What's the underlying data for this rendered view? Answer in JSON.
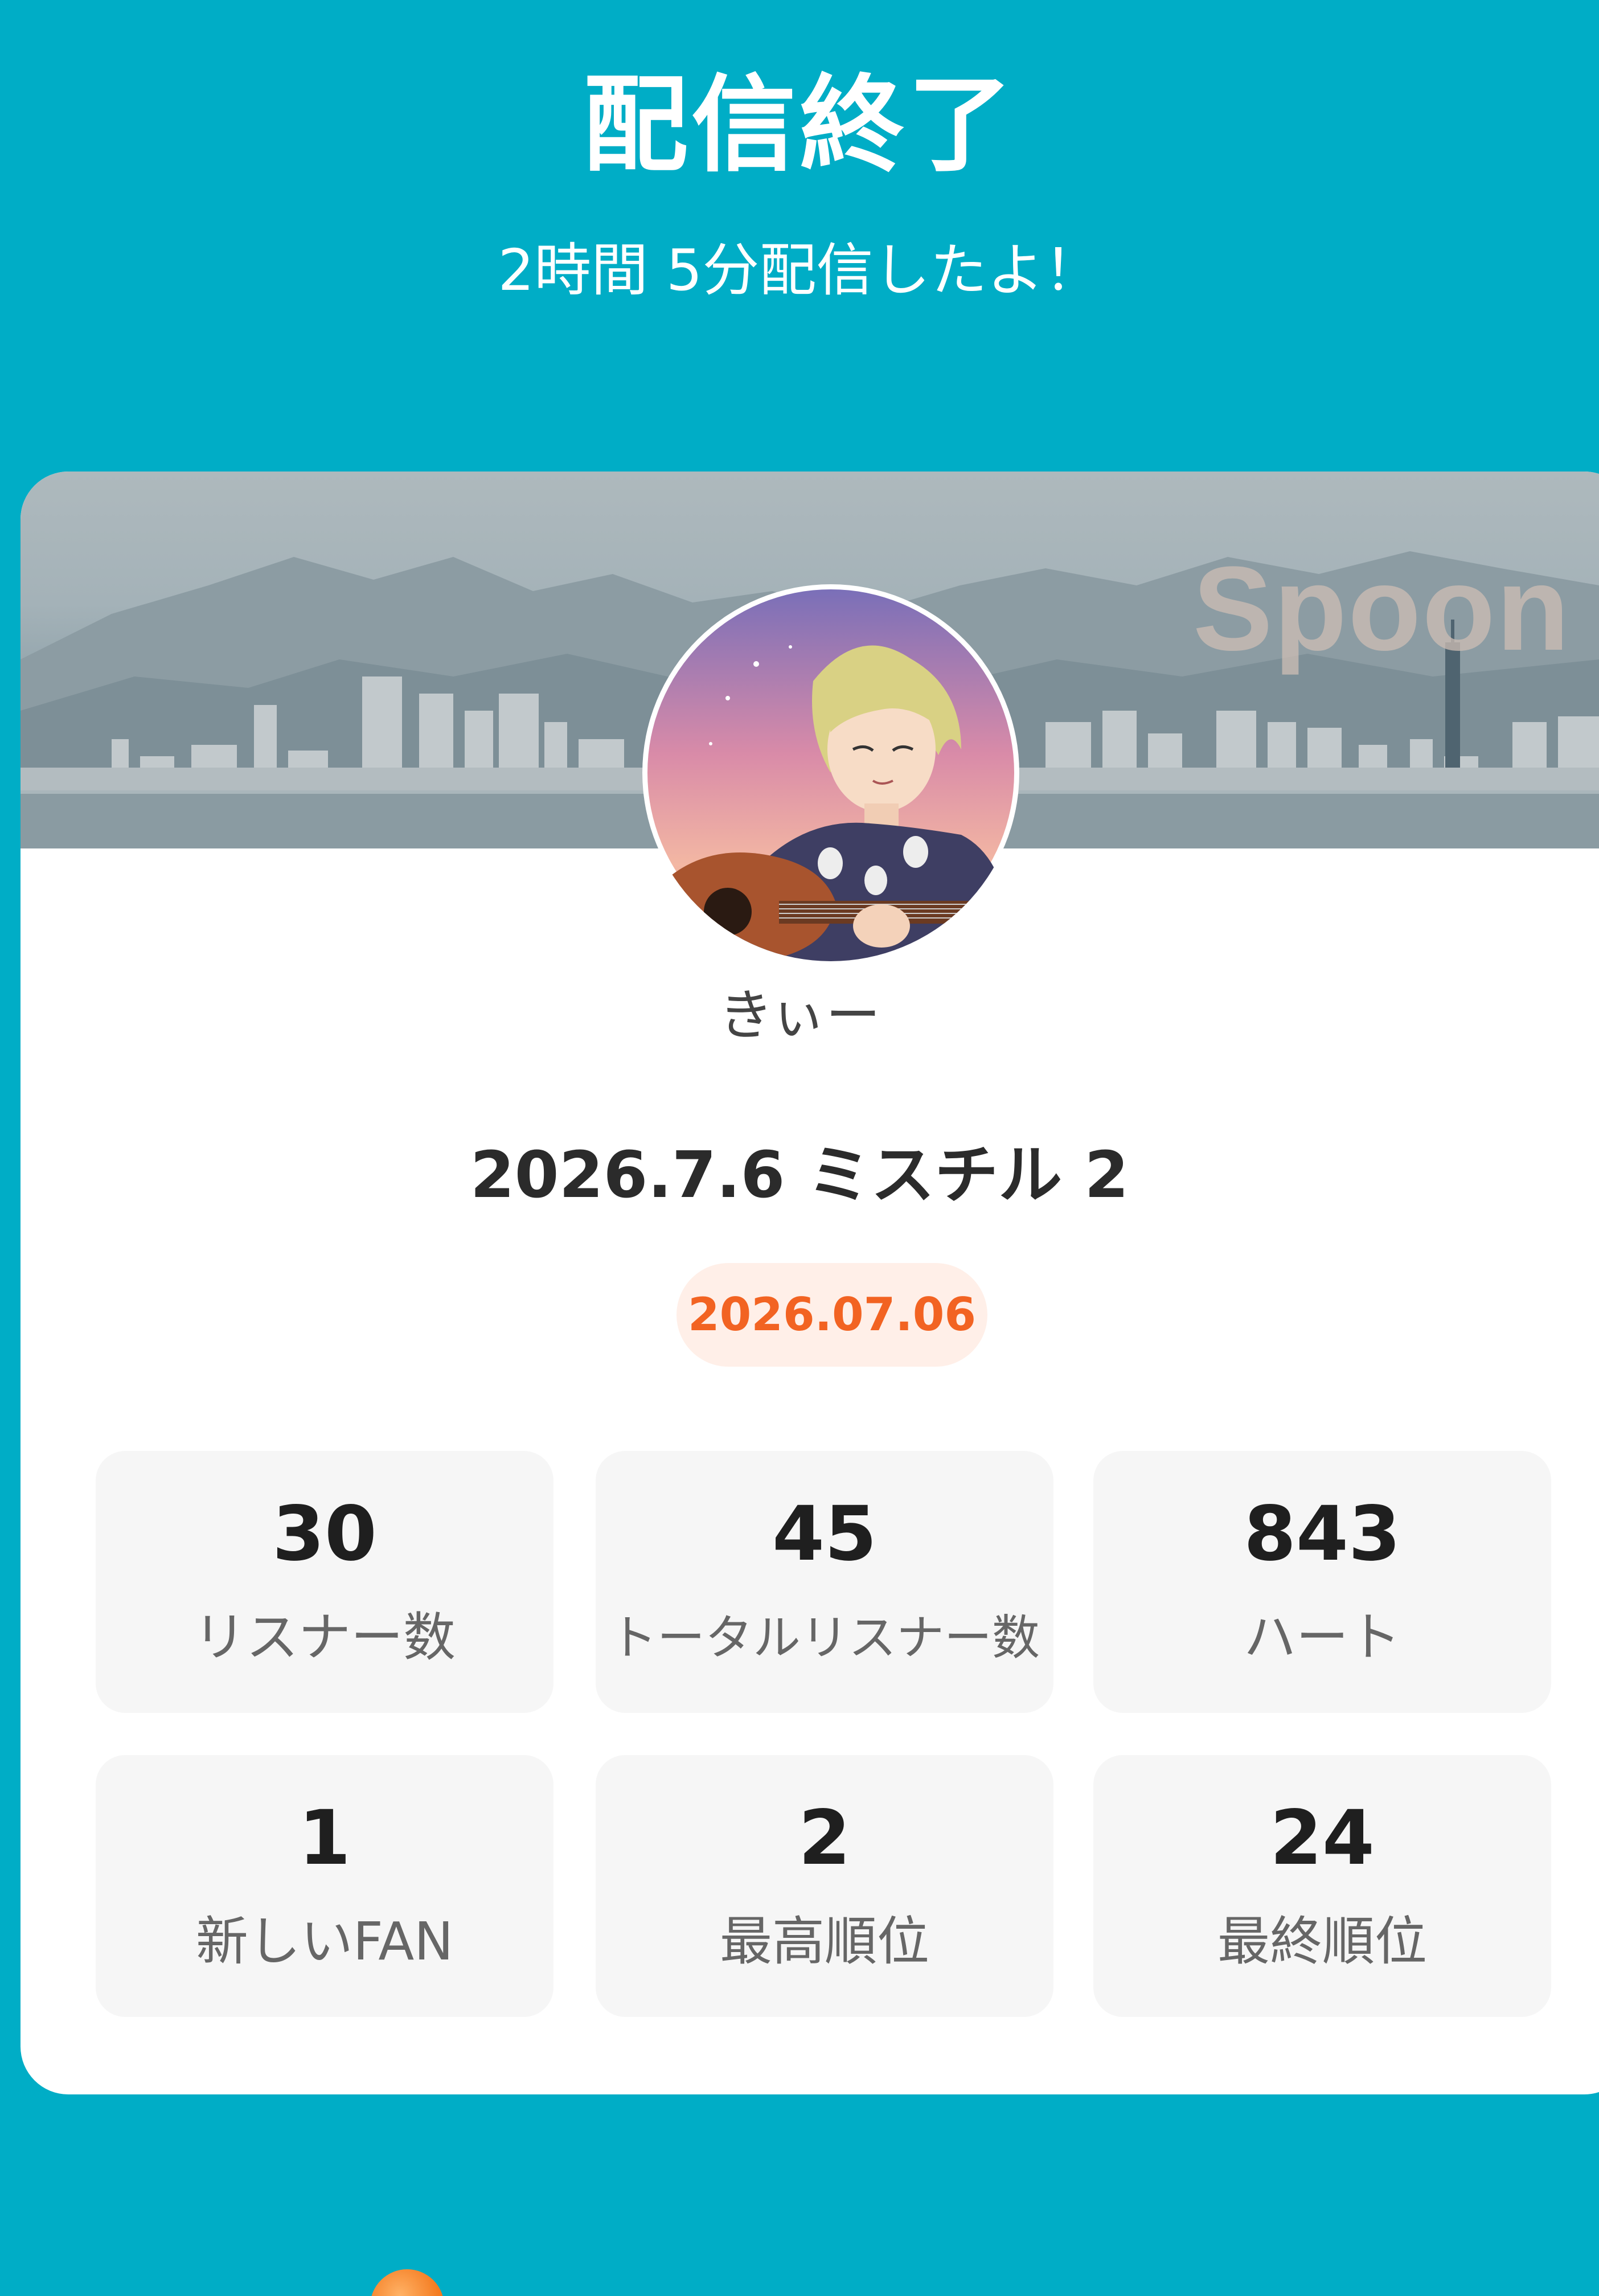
{
  "header": {
    "title": "配信終了",
    "subtitle": "2時間 5分配信したよ！"
  },
  "banner": {
    "logo_text": "Spoon"
  },
  "profile": {
    "username": "きぃー",
    "avatar_icon": "avatar-illustration-icon"
  },
  "broadcast": {
    "title": "2026.7.6 ミスチル 2",
    "date": "2026.07.06"
  },
  "stats": [
    {
      "value": "30",
      "label": "リスナー数"
    },
    {
      "value": "45",
      "label": "トータルリスナー数"
    },
    {
      "value": "843",
      "label": "ハート"
    },
    {
      "value": "1",
      "label": "新しいFAN"
    },
    {
      "value": "2",
      "label": "最高順位"
    },
    {
      "value": "24",
      "label": "最終順位"
    }
  ],
  "footer": {
    "spoon_icon": "coin-icon"
  },
  "colors": {
    "background": "#00ADC6",
    "card": "#FFFFFF",
    "date_badge_bg": "#FFEFE8",
    "date_badge_text": "#F26322",
    "stat_bg": "#F6F6F6"
  }
}
